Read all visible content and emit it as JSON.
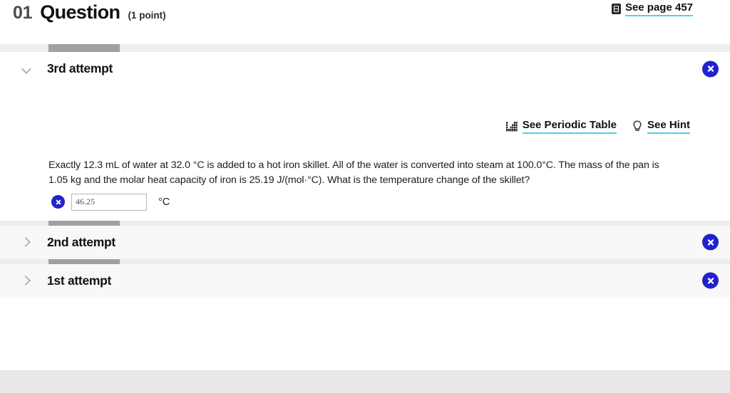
{
  "header": {
    "question_number": "01",
    "title": "Question",
    "points": "(1 point)",
    "reference_link": "See page 457",
    "reference_icon": "book-icon"
  },
  "tools": {
    "periodic_table": "See Periodic Table",
    "periodic_table_icon": "periodic-table-icon",
    "hint": "See Hint",
    "hint_icon": "lightbulb-icon"
  },
  "attempts": [
    {
      "label": "3rd attempt",
      "state": "open",
      "chevron": "chevron-down-icon",
      "status_icon": "incorrect-x-icon"
    },
    {
      "label": "2nd attempt",
      "state": "closed",
      "chevron": "chevron-right-icon",
      "status_icon": "incorrect-x-icon"
    },
    {
      "label": "1st attempt",
      "state": "closed",
      "chevron": "chevron-right-icon",
      "status_icon": "incorrect-x-icon"
    }
  ],
  "question": {
    "body": "Exactly 12.3  mL of water at 32.0 °C is added to a hot iron skillet. All of the water is converted into steam at 100.0°C. The mass of the pan is 1.05  kg and the molar heat capacity of iron is 25.19 J/(mol·°C). What is the temperature change of the skillet?",
    "answer_value": "46.25",
    "answer_placeholder": "",
    "answer_unit": "°C",
    "answer_status_icon": "incorrect-x-icon"
  },
  "colors": {
    "accent_blue": "#2222cc",
    "link_underline": "#4dd3e3",
    "progress_fill": "#a0a0a0",
    "progress_track": "#eceded",
    "closed_row_bg": "#f8f8f8",
    "footer_band": "#e9e9e9"
  }
}
